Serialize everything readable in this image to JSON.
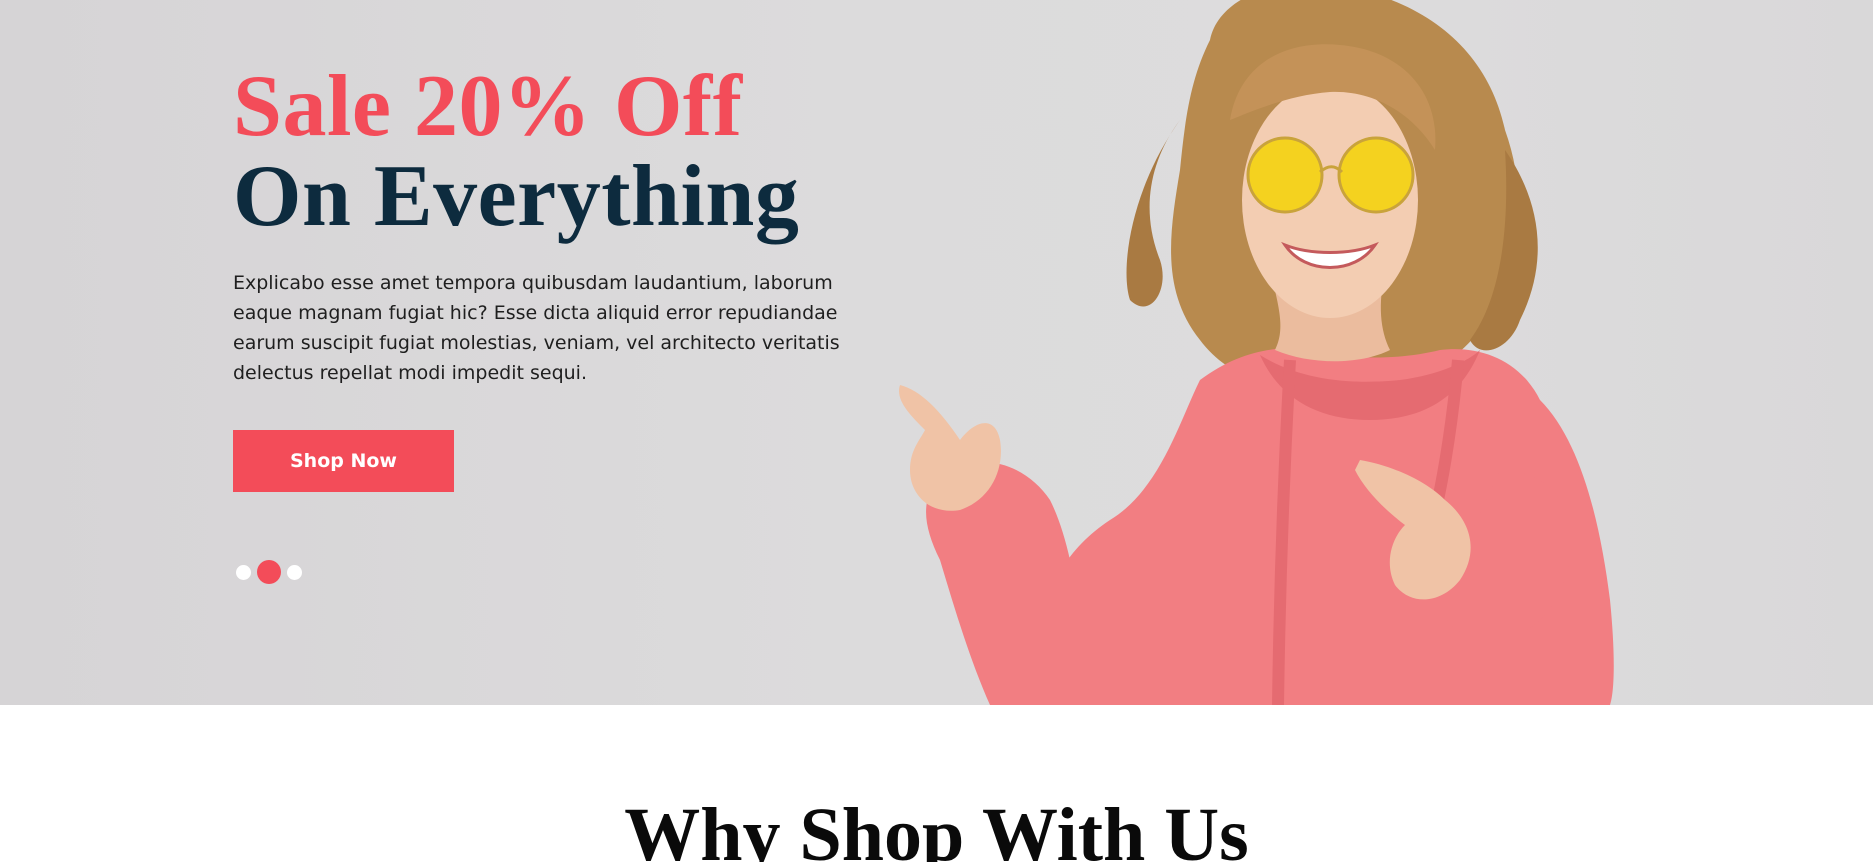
{
  "hero": {
    "headline_line1": "Sale 20% Off",
    "headline_line2": "On Everything",
    "description": "Explicabo esse amet tempora quibusdam laudantium, laborum eaque magnam fugiat hic? Esse dicta aliquid error repudiandae earum suscipit fugiat molestias, veniam, vel architecto veritatis delectus repellat modi impedit sequi.",
    "cta_label": "Shop Now",
    "slider": {
      "slide_count": 3,
      "active_index": 1
    },
    "image": "woman-in-pink-hoodie-pointing"
  },
  "section": {
    "title": "Why Shop With Us"
  },
  "colors": {
    "accent": "#f34c59",
    "headline_dark": "#0d2b3e",
    "hero_background": "#dcdbdc",
    "hoodie": "#f27e82"
  }
}
